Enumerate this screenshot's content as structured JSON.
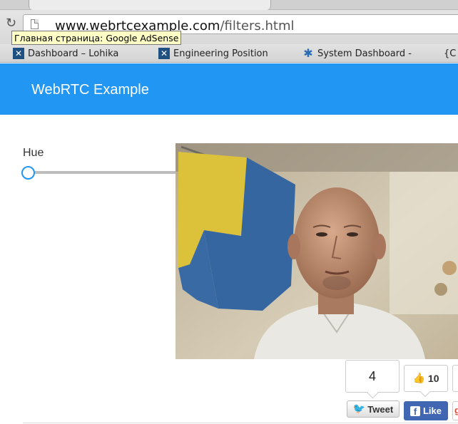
{
  "browser": {
    "url": {
      "host": "www.webrtcexample.com",
      "path": "/filters.html"
    },
    "tooltip": "Главная страница: Google AdSense",
    "bookmarks": [
      {
        "label": "Dashboard – Lohika",
        "icon": "jira-icon"
      },
      {
        "label": "Engineering Position",
        "icon": "jira-icon"
      },
      {
        "label": "System Dashboard -",
        "icon": "confluence-icon"
      },
      {
        "label": "{C",
        "icon": "bracket-icon"
      }
    ]
  },
  "navbar": {
    "brand": "WebRTC Example",
    "color": "#2196f3"
  },
  "controls": {
    "hue": {
      "label": "Hue",
      "value_fraction": 0.0
    }
  },
  "share": {
    "tweet_count": "4",
    "tweet_label": "Tweet",
    "like_count": "10",
    "like_label": "Like"
  },
  "colors": {
    "accent": "#2196f3",
    "facebook": "#4267b2",
    "twitter": "#2aa9e0"
  }
}
